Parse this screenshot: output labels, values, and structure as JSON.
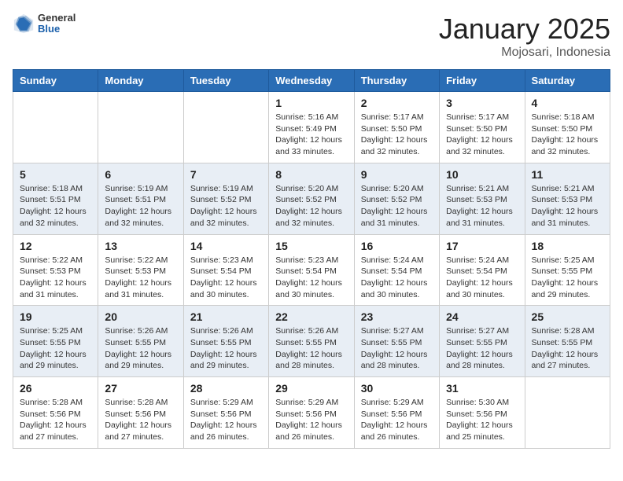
{
  "header": {
    "logo_general": "General",
    "logo_blue": "Blue",
    "month_title": "January 2025",
    "location": "Mojosari, Indonesia"
  },
  "weekdays": [
    "Sunday",
    "Monday",
    "Tuesday",
    "Wednesday",
    "Thursday",
    "Friday",
    "Saturday"
  ],
  "weeks": [
    [
      {
        "day": "",
        "sunrise": "",
        "sunset": "",
        "daylight": ""
      },
      {
        "day": "",
        "sunrise": "",
        "sunset": "",
        "daylight": ""
      },
      {
        "day": "",
        "sunrise": "",
        "sunset": "",
        "daylight": ""
      },
      {
        "day": "1",
        "sunrise": "Sunrise: 5:16 AM",
        "sunset": "Sunset: 5:49 PM",
        "daylight": "Daylight: 12 hours and 33 minutes."
      },
      {
        "day": "2",
        "sunrise": "Sunrise: 5:17 AM",
        "sunset": "Sunset: 5:50 PM",
        "daylight": "Daylight: 12 hours and 32 minutes."
      },
      {
        "day": "3",
        "sunrise": "Sunrise: 5:17 AM",
        "sunset": "Sunset: 5:50 PM",
        "daylight": "Daylight: 12 hours and 32 minutes."
      },
      {
        "day": "4",
        "sunrise": "Sunrise: 5:18 AM",
        "sunset": "Sunset: 5:50 PM",
        "daylight": "Daylight: 12 hours and 32 minutes."
      }
    ],
    [
      {
        "day": "5",
        "sunrise": "Sunrise: 5:18 AM",
        "sunset": "Sunset: 5:51 PM",
        "daylight": "Daylight: 12 hours and 32 minutes."
      },
      {
        "day": "6",
        "sunrise": "Sunrise: 5:19 AM",
        "sunset": "Sunset: 5:51 PM",
        "daylight": "Daylight: 12 hours and 32 minutes."
      },
      {
        "day": "7",
        "sunrise": "Sunrise: 5:19 AM",
        "sunset": "Sunset: 5:52 PM",
        "daylight": "Daylight: 12 hours and 32 minutes."
      },
      {
        "day": "8",
        "sunrise": "Sunrise: 5:20 AM",
        "sunset": "Sunset: 5:52 PM",
        "daylight": "Daylight: 12 hours and 32 minutes."
      },
      {
        "day": "9",
        "sunrise": "Sunrise: 5:20 AM",
        "sunset": "Sunset: 5:52 PM",
        "daylight": "Daylight: 12 hours and 31 minutes."
      },
      {
        "day": "10",
        "sunrise": "Sunrise: 5:21 AM",
        "sunset": "Sunset: 5:53 PM",
        "daylight": "Daylight: 12 hours and 31 minutes."
      },
      {
        "day": "11",
        "sunrise": "Sunrise: 5:21 AM",
        "sunset": "Sunset: 5:53 PM",
        "daylight": "Daylight: 12 hours and 31 minutes."
      }
    ],
    [
      {
        "day": "12",
        "sunrise": "Sunrise: 5:22 AM",
        "sunset": "Sunset: 5:53 PM",
        "daylight": "Daylight: 12 hours and 31 minutes."
      },
      {
        "day": "13",
        "sunrise": "Sunrise: 5:22 AM",
        "sunset": "Sunset: 5:53 PM",
        "daylight": "Daylight: 12 hours and 31 minutes."
      },
      {
        "day": "14",
        "sunrise": "Sunrise: 5:23 AM",
        "sunset": "Sunset: 5:54 PM",
        "daylight": "Daylight: 12 hours and 30 minutes."
      },
      {
        "day": "15",
        "sunrise": "Sunrise: 5:23 AM",
        "sunset": "Sunset: 5:54 PM",
        "daylight": "Daylight: 12 hours and 30 minutes."
      },
      {
        "day": "16",
        "sunrise": "Sunrise: 5:24 AM",
        "sunset": "Sunset: 5:54 PM",
        "daylight": "Daylight: 12 hours and 30 minutes."
      },
      {
        "day": "17",
        "sunrise": "Sunrise: 5:24 AM",
        "sunset": "Sunset: 5:54 PM",
        "daylight": "Daylight: 12 hours and 30 minutes."
      },
      {
        "day": "18",
        "sunrise": "Sunrise: 5:25 AM",
        "sunset": "Sunset: 5:55 PM",
        "daylight": "Daylight: 12 hours and 29 minutes."
      }
    ],
    [
      {
        "day": "19",
        "sunrise": "Sunrise: 5:25 AM",
        "sunset": "Sunset: 5:55 PM",
        "daylight": "Daylight: 12 hours and 29 minutes."
      },
      {
        "day": "20",
        "sunrise": "Sunrise: 5:26 AM",
        "sunset": "Sunset: 5:55 PM",
        "daylight": "Daylight: 12 hours and 29 minutes."
      },
      {
        "day": "21",
        "sunrise": "Sunrise: 5:26 AM",
        "sunset": "Sunset: 5:55 PM",
        "daylight": "Daylight: 12 hours and 29 minutes."
      },
      {
        "day": "22",
        "sunrise": "Sunrise: 5:26 AM",
        "sunset": "Sunset: 5:55 PM",
        "daylight": "Daylight: 12 hours and 28 minutes."
      },
      {
        "day": "23",
        "sunrise": "Sunrise: 5:27 AM",
        "sunset": "Sunset: 5:55 PM",
        "daylight": "Daylight: 12 hours and 28 minutes."
      },
      {
        "day": "24",
        "sunrise": "Sunrise: 5:27 AM",
        "sunset": "Sunset: 5:55 PM",
        "daylight": "Daylight: 12 hours and 28 minutes."
      },
      {
        "day": "25",
        "sunrise": "Sunrise: 5:28 AM",
        "sunset": "Sunset: 5:55 PM",
        "daylight": "Daylight: 12 hours and 27 minutes."
      }
    ],
    [
      {
        "day": "26",
        "sunrise": "Sunrise: 5:28 AM",
        "sunset": "Sunset: 5:56 PM",
        "daylight": "Daylight: 12 hours and 27 minutes."
      },
      {
        "day": "27",
        "sunrise": "Sunrise: 5:28 AM",
        "sunset": "Sunset: 5:56 PM",
        "daylight": "Daylight: 12 hours and 27 minutes."
      },
      {
        "day": "28",
        "sunrise": "Sunrise: 5:29 AM",
        "sunset": "Sunset: 5:56 PM",
        "daylight": "Daylight: 12 hours and 26 minutes."
      },
      {
        "day": "29",
        "sunrise": "Sunrise: 5:29 AM",
        "sunset": "Sunset: 5:56 PM",
        "daylight": "Daylight: 12 hours and 26 minutes."
      },
      {
        "day": "30",
        "sunrise": "Sunrise: 5:29 AM",
        "sunset": "Sunset: 5:56 PM",
        "daylight": "Daylight: 12 hours and 26 minutes."
      },
      {
        "day": "31",
        "sunrise": "Sunrise: 5:30 AM",
        "sunset": "Sunset: 5:56 PM",
        "daylight": "Daylight: 12 hours and 25 minutes."
      },
      {
        "day": "",
        "sunrise": "",
        "sunset": "",
        "daylight": ""
      }
    ]
  ]
}
